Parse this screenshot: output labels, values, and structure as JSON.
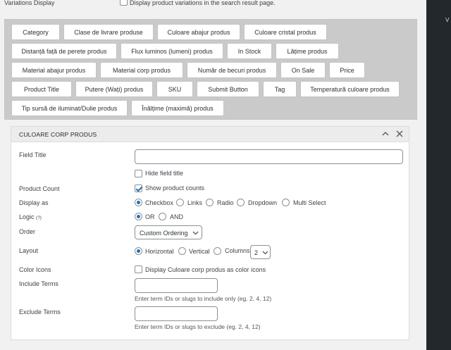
{
  "top_row": {
    "label": "Variations Display",
    "checkbox_text": "Display product variations in the search result page."
  },
  "chips": [
    "Category",
    "Clase de livrare produse",
    "Culoare abajur produs",
    "Culoare cristal produs",
    "Distanță față de perete produs",
    "Flux luminos (lumeni) produs",
    "In Stock",
    "Lățime produs",
    "Material abajur produs",
    "Material corp produs",
    "Număr de becuri produs",
    "On Sale",
    "Price",
    "Product Title",
    "Putere (Wați) produs",
    "SKU",
    "Submit Button",
    "Tag",
    "Temperatură culoare produs",
    "Tip sursă de iluminat/Dulie produs",
    "Înălțime (maximă) produs"
  ],
  "panel": {
    "title": "CULOARE CORP PRODUS",
    "field_title": {
      "label": "Field Title",
      "value": "",
      "placeholder": ""
    },
    "hide_title": {
      "label": "Hide field title",
      "checked": false
    },
    "product_count": {
      "label": "Product Count",
      "option": "Show product counts",
      "checked": true
    },
    "display_as": {
      "label": "Display as",
      "options": [
        "Checkbox",
        "Links",
        "Radio",
        "Dropdown",
        "Multi Select"
      ],
      "selected": "Checkbox"
    },
    "logic": {
      "label": "Logic",
      "help": "(?)",
      "options": [
        "OR",
        "AND"
      ],
      "selected": "OR"
    },
    "order": {
      "label": "Order",
      "value": "Custom Ordering"
    },
    "layout": {
      "label": "Layout",
      "options": [
        "Horizontal",
        "Vertical",
        "Columns"
      ],
      "selected": "Horizontal",
      "columns": "2"
    },
    "color_icons": {
      "label": "Color Icons",
      "option": "Display Culoare corp produs as color icons",
      "checked": false
    },
    "include_terms": {
      "label": "Include Terms",
      "value": "",
      "desc": "Enter term IDs or slugs to include only (eg. 2, 4, 12)"
    },
    "exclude_terms": {
      "label": "Exclude Terms",
      "value": "",
      "desc": "Enter term IDs or slugs to exclude (eg. 2, 4, 12)"
    }
  },
  "side_glyph": "V"
}
